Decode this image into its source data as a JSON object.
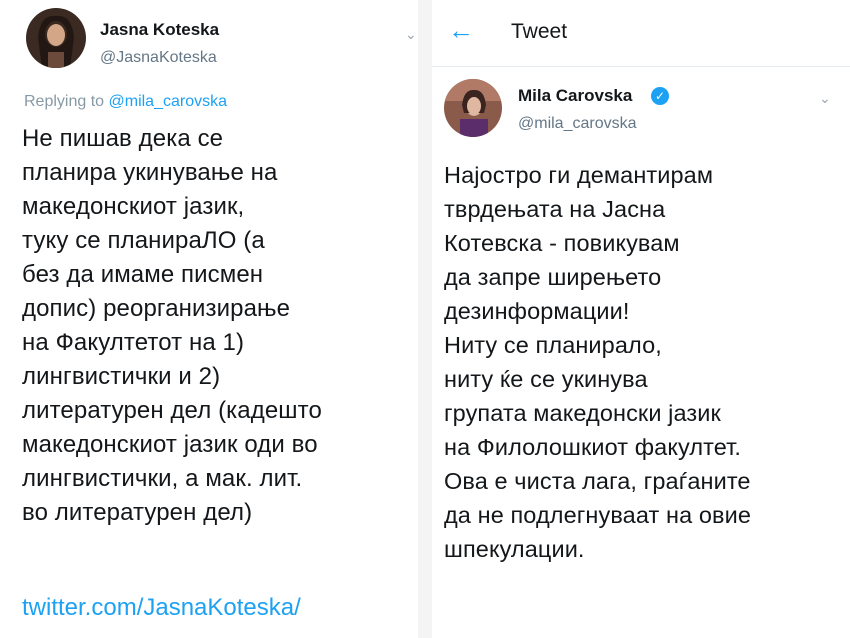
{
  "left": {
    "author_name": "Jasna Koteska",
    "author_handle": "@JasnaKoteska",
    "replying_prefix": "Replying to ",
    "replying_handle": "@mila_carovska",
    "body": "Не пишав дека се\nпланира укинување на\nмакедонскиот јазик,\nтуку се планираЛО (а\nбез да имаме писмен\nдопис) реорганизирање\nна Факултетот на 1)\nлингвистички и 2)\nлитературен дел (кадешто\nмакедонскиот јазик оди во\nлингвистички, а мак. лит.\nво литературен дел)",
    "link": "twitter.com/JasnaKoteska/",
    "menu_icon": "chevron-down-icon"
  },
  "right": {
    "header_title": "Tweet",
    "back_icon": "arrow-left-icon",
    "author_name": "Mila Carovska",
    "author_handle": "@mila_carovska",
    "verified_icon": "verified-badge-icon",
    "body": "Најостро ги демантирам\nтврдењата на Јасна\nКотевска - повикувам\nда запре ширењето\nдезинформации!\nНиту се планирало,\nниту ќе се укинува\nгрупата македонски јазик\nна Филолошкиот факултет.\nОва е чиста лага, граѓаните\nда не подлегнуваат на овие\nшпекулации.",
    "menu_icon": "chevron-down-icon"
  },
  "colors": {
    "link": "#1da1f2",
    "text": "#14171a",
    "muted": "#657786",
    "divider": "#f4f4f4"
  }
}
